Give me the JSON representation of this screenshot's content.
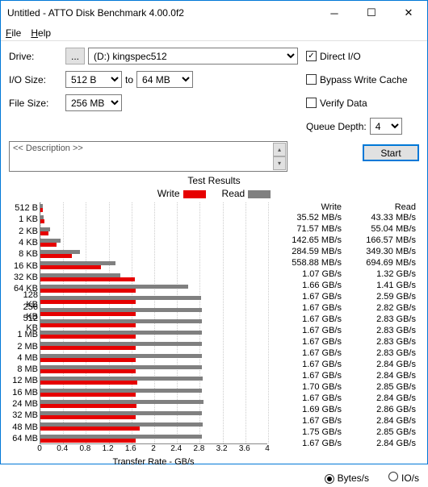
{
  "window": {
    "title": "Untitled - ATTO Disk Benchmark 4.00.0f2"
  },
  "menu": {
    "file": "File",
    "help": "Help"
  },
  "config": {
    "drive_label": "Drive:",
    "drive_btn": "...",
    "drive_value": "(D:) kingspec512",
    "iosize_label": "I/O Size:",
    "iosize_from": "512 B",
    "iosize_to_word": "to",
    "iosize_to": "64 MB",
    "filesize_label": "File Size:",
    "filesize_value": "256 MB",
    "direct_io": "Direct I/O",
    "bypass": "Bypass Write Cache",
    "verify": "Verify Data",
    "queue_label": "Queue Depth:",
    "queue_value": "4",
    "start": "Start",
    "description": "<< Description >>"
  },
  "results_title": "Test Results",
  "legend": {
    "write": "Write",
    "read": "Read"
  },
  "axis": {
    "xlabel": "Transfer Rate - GB/s"
  },
  "footer": {
    "bytes": "Bytes/s",
    "io": "IO/s"
  },
  "chart_data": {
    "type": "bar",
    "xlim": [
      0,
      4
    ],
    "xticks": [
      0,
      0.4,
      0.8,
      1.2,
      1.6,
      2.0,
      2.4,
      2.8,
      3.2,
      3.6,
      4
    ],
    "series": [
      "Write",
      "Read"
    ],
    "rows": [
      {
        "label": "512 B",
        "write": 0.03552,
        "read": 0.04333,
        "write_s": "35.52 MB/s",
        "read_s": "43.33 MB/s"
      },
      {
        "label": "1 KB",
        "write": 0.07157,
        "read": 0.05504,
        "write_s": "71.57 MB/s",
        "read_s": "55.04 MB/s"
      },
      {
        "label": "2 KB",
        "write": 0.14265,
        "read": 0.16657,
        "write_s": "142.65 MB/s",
        "read_s": "166.57 MB/s"
      },
      {
        "label": "4 KB",
        "write": 0.28459,
        "read": 0.3493,
        "write_s": "284.59 MB/s",
        "read_s": "349.30 MB/s"
      },
      {
        "label": "8 KB",
        "write": 0.55888,
        "read": 0.69469,
        "write_s": "558.88 MB/s",
        "read_s": "694.69 MB/s"
      },
      {
        "label": "16 KB",
        "write": 1.07,
        "read": 1.32,
        "write_s": "1.07 GB/s",
        "read_s": "1.32 GB/s"
      },
      {
        "label": "32 KB",
        "write": 1.66,
        "read": 1.41,
        "write_s": "1.66 GB/s",
        "read_s": "1.41 GB/s"
      },
      {
        "label": "64 KB",
        "write": 1.67,
        "read": 2.59,
        "write_s": "1.67 GB/s",
        "read_s": "2.59 GB/s"
      },
      {
        "label": "128 KB",
        "write": 1.67,
        "read": 2.82,
        "write_s": "1.67 GB/s",
        "read_s": "2.82 GB/s"
      },
      {
        "label": "256 KB",
        "write": 1.67,
        "read": 2.83,
        "write_s": "1.67 GB/s",
        "read_s": "2.83 GB/s"
      },
      {
        "label": "512 KB",
        "write": 1.67,
        "read": 2.83,
        "write_s": "1.67 GB/s",
        "read_s": "2.83 GB/s"
      },
      {
        "label": "1 MB",
        "write": 1.67,
        "read": 2.83,
        "write_s": "1.67 GB/s",
        "read_s": "2.83 GB/s"
      },
      {
        "label": "2 MB",
        "write": 1.67,
        "read": 2.83,
        "write_s": "1.67 GB/s",
        "read_s": "2.83 GB/s"
      },
      {
        "label": "4 MB",
        "write": 1.67,
        "read": 2.84,
        "write_s": "1.67 GB/s",
        "read_s": "2.84 GB/s"
      },
      {
        "label": "8 MB",
        "write": 1.67,
        "read": 2.84,
        "write_s": "1.67 GB/s",
        "read_s": "2.84 GB/s"
      },
      {
        "label": "12 MB",
        "write": 1.7,
        "read": 2.85,
        "write_s": "1.70 GB/s",
        "read_s": "2.85 GB/s"
      },
      {
        "label": "16 MB",
        "write": 1.67,
        "read": 2.84,
        "write_s": "1.67 GB/s",
        "read_s": "2.84 GB/s"
      },
      {
        "label": "24 MB",
        "write": 1.69,
        "read": 2.86,
        "write_s": "1.69 GB/s",
        "read_s": "2.86 GB/s"
      },
      {
        "label": "32 MB",
        "write": 1.67,
        "read": 2.84,
        "write_s": "1.67 GB/s",
        "read_s": "2.84 GB/s"
      },
      {
        "label": "48 MB",
        "write": 1.75,
        "read": 2.85,
        "write_s": "1.75 GB/s",
        "read_s": "2.85 GB/s"
      },
      {
        "label": "64 MB",
        "write": 1.67,
        "read": 2.84,
        "write_s": "1.67 GB/s",
        "read_s": "2.84 GB/s"
      }
    ]
  }
}
